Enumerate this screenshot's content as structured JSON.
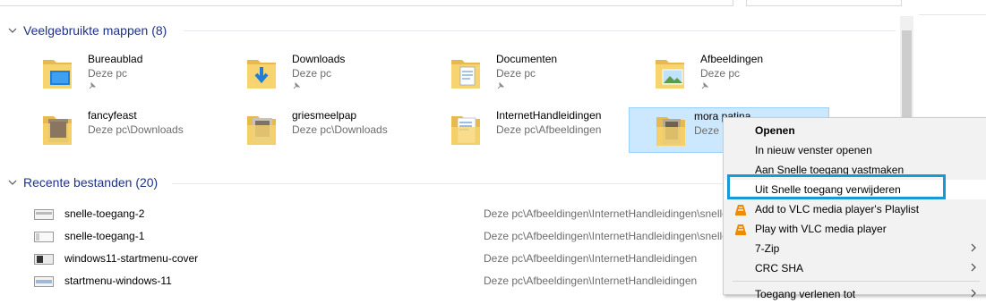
{
  "groups": {
    "frequent": {
      "label": "Veelgebruikte mappen (8)"
    },
    "recent": {
      "label": "Recente bestanden (20)"
    }
  },
  "folders": [
    {
      "name": "Bureaublad",
      "path": "Deze pc",
      "pinned": true,
      "icon": "desktop-folder-icon"
    },
    {
      "name": "Downloads",
      "path": "Deze pc",
      "pinned": true,
      "icon": "downloads-folder-icon"
    },
    {
      "name": "Documenten",
      "path": "Deze pc",
      "pinned": true,
      "icon": "documents-folder-icon"
    },
    {
      "name": "Afbeeldingen",
      "path": "Deze pc",
      "pinned": true,
      "icon": "pictures-folder-icon"
    },
    {
      "name": "fancyfeast",
      "path": "Deze pc\\Downloads",
      "pinned": false,
      "icon": "folder-icon"
    },
    {
      "name": "griesmeelpap",
      "path": "Deze pc\\Downloads",
      "pinned": false,
      "icon": "folder-icon"
    },
    {
      "name": "InternetHandleidingen",
      "path": "Deze pc\\Afbeeldingen",
      "pinned": false,
      "icon": "folder-icon"
    },
    {
      "name": "mora patina",
      "path": "Deze pc",
      "pinned": false,
      "icon": "folder-icon"
    }
  ],
  "files": [
    {
      "name": "snelle-toegang-2",
      "path": "Deze pc\\Afbeeldingen\\InternetHandleidingen\\snelle-toegang"
    },
    {
      "name": "snelle-toegang-1",
      "path": "Deze pc\\Afbeeldingen\\InternetHandleidingen\\snelle-toegang"
    },
    {
      "name": "windows11-startmenu-cover",
      "path": "Deze pc\\Afbeeldingen\\InternetHandleidingen"
    },
    {
      "name": "startmenu-windows-11",
      "path": "Deze pc\\Afbeeldingen\\InternetHandleidingen"
    }
  ],
  "context_menu": {
    "items": [
      {
        "label": "Openen",
        "bold": true,
        "icon": "",
        "submenu": false
      },
      {
        "label": "In nieuw venster openen",
        "bold": false,
        "icon": "",
        "submenu": false
      },
      {
        "label": "Aan Snelle toegang vastmaken",
        "bold": false,
        "icon": "",
        "submenu": false
      },
      {
        "label": "Uit Snelle toegang verwijderen",
        "bold": false,
        "icon": "",
        "submenu": false,
        "highlighted": true
      },
      {
        "label": "Add to VLC media player's Playlist",
        "bold": false,
        "icon": "vlc-cone-icon",
        "submenu": false
      },
      {
        "label": "Play with VLC media player",
        "bold": false,
        "icon": "vlc-cone-icon",
        "submenu": false
      },
      {
        "label": "7-Zip",
        "bold": false,
        "icon": "",
        "submenu": true
      },
      {
        "label": "CRC SHA",
        "bold": false,
        "icon": "",
        "submenu": true
      },
      {
        "label": "Toegang verlenen tot",
        "bold": false,
        "icon": "",
        "submenu": true
      }
    ]
  },
  "colors": {
    "header_text": "#1e3287",
    "selection_bg": "#cce8ff",
    "callout_border": "#149ad4",
    "secondary_text": "#6d6d6d"
  }
}
